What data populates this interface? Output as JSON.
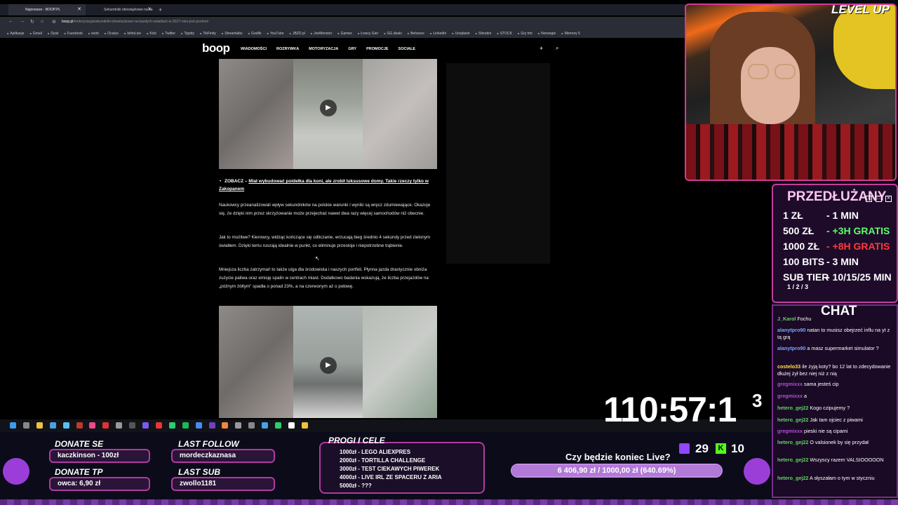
{
  "browser": {
    "tabs": [
      {
        "label": "Najnowsze - BOOP.PL",
        "active": true
      },
      {
        "label": "Sekundniki obowiązkowe na ka",
        "active": false
      }
    ],
    "url_host": "boop.pl",
    "url_path": "/motoryzacja/sekundniki-obowiazkowe-na-kazdych-swiatlach-w-2027-roku-jest-przelom",
    "bookmarks": [
      "Aplikacje",
      "Gmail",
      "Dysk",
      "Facebook",
      "work",
      "Oculus",
      "IshinLive",
      "Kick",
      "Twitter",
      "Tippity",
      "TikFinity",
      "Streamlabs",
      "Grafiki",
      "YouTube",
      "JBZD.pl",
      "JoeMonster",
      "Games",
      "Łowcy Gier",
      "GG.deals",
      "Behance",
      "LinkedIn",
      "Unsplash",
      "Shinden",
      "STOCK",
      "Gry tmt",
      "Norwegie",
      "Memory 5"
    ]
  },
  "site": {
    "logo": "boop",
    "nav": [
      "WIADOMOŚCI",
      "ROZRYWKA",
      "MOTORYZACJA",
      "GRY",
      "PROMOCJE",
      "SOCIALE"
    ]
  },
  "article": {
    "related_lead": "ZOBACZ –",
    "related_link": "Miał wybudować poidełka dla koni, ale zrobił luksusowe domy. Takie rzeczy tylko w Zakopanem",
    "p1": "Naukowcy przeanalizowali wpływ sekundników na polskie warunki i wyniki są wręcz zdumiewające. Okazuje się, że dzięki nim przez skrzyżowanie może przejechać nawet dwa razy więcej samochodów niż obecnie.",
    "p2": "Jak to możliwe? Kierowcy, widząc kończące się odliczanie, wrzucają bieg średnio 4 sekundy przed zielonym światłem. Dzięki temu ruszają idealnie w punkt, co eliminuje przestoje i niepotrzebne trąbienie.",
    "p3": "Mniejsza liczba zatrzymań to także ulga dla środowiska i naszych portfeli. Płynna jazda drastycznie obniża zużycie paliwa oraz emisję spalin w centrach miast. Dodatkowo badania wskazują, że liczba przejazdów na „późnym żółtym\" spadła o ponad 23%, a na czerwonym aż o połowę."
  },
  "overlay": {
    "level_up": "LEVEL UP",
    "timer": "110:57:1",
    "timer_sup": "3",
    "rules_title": "PRZEDŁUŻANY",
    "rules": [
      {
        "amount": "1 ZŁ",
        "value": "- 1 MIN",
        "color": "white"
      },
      {
        "amount": "500 ZŁ",
        "value": "- +3H GRATIS",
        "color": "green"
      },
      {
        "amount": "1000 ZŁ",
        "value": "- +8H GRATIS",
        "color": "red"
      },
      {
        "amount": "100 BITS",
        "value": "- 3 MIN",
        "color": "white"
      },
      {
        "amount": "SUB TIER",
        "value": "- 10/15/25 MIN",
        "color": "white"
      }
    ],
    "sub_tier_sub": "1 / 2 / 3",
    "chat_title": "CHAT",
    "chat": [
      {
        "user": "J_Karol",
        "text": "Fochu",
        "color": "#6ad16a"
      },
      {
        "user": "alanytpro90",
        "text": "natan to musisz obejrzeć influ na yt z tą grą",
        "color": "#7aa6ff"
      },
      {
        "user": "alanytpro90",
        "text": "a masz supermarket simulator ?",
        "color": "#7aa6ff"
      },
      {
        "user": "costelo33",
        "text": "ile żyją koty? bo 12 lat to zdecydowanie dłużej żył bez niej niż z nią",
        "color": "#ffe14a"
      },
      {
        "user": "gregmixxx",
        "text": "sama jesteś cip",
        "color": "#b44cd8"
      },
      {
        "user": "gregmixxx",
        "text": "a",
        "color": "#b44cd8"
      },
      {
        "user": "hetero_gej22",
        "text": "Kogo czipujemy ?",
        "color": "#5bd85b"
      },
      {
        "user": "hetero_gej22",
        "text": "Jak tam ojciec z piwami",
        "color": "#5bd85b"
      },
      {
        "user": "gregmixxx",
        "text": "pieski nie są cipami",
        "color": "#b44cd8"
      },
      {
        "user": "hetero_gej22",
        "text": "O valsionek by się przydał",
        "color": "#5bd85b"
      },
      {
        "user": "hetero_gej22",
        "text": "Wszyscy razem VALSIOOOOON",
        "color": "#5bd85b"
      },
      {
        "user": "hetero_gej22",
        "text": "A słyszałam o tym w styczniu",
        "color": "#5bd85b"
      }
    ],
    "donate_se_label": "DONATE SE",
    "donate_se_value": "kaczkinson - 100zł",
    "donate_tp_label": "DONATE TP",
    "donate_tp_value": "owca: 6,90 zł",
    "last_follow_label": "LAST FOLLOW",
    "last_follow_value": "mordeczkaznasa",
    "last_sub_label": "LAST SUB",
    "last_sub_value": "zwollo1181",
    "goals_title": "PROGI I CELE",
    "goals": [
      "1000zł - LEGO ALIEXPRES",
      "2000zł - TORTILLA CHALLENGE",
      "3000zł - TEST CIEKAWYCH PIWEREK",
      "4000zł - LIVE IRL ZE SPACERU Z ARIA",
      "5000zł - ???"
    ],
    "question": "Czy będzie koniec Live?",
    "progress_text": "6 406,90 zł / 1000,00 zł (640.69%)",
    "progress_fraction": 1,
    "twitch_count": "29",
    "kick_count": "10",
    "kick_glyph": "K"
  }
}
